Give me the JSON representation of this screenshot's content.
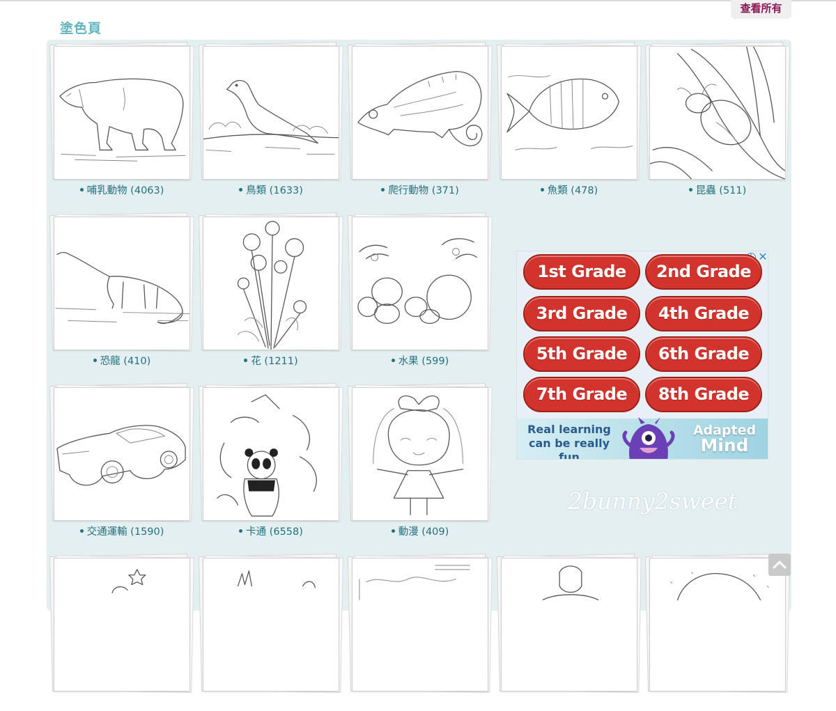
{
  "header": {
    "view_all": "查看所有",
    "section_title": "塗色頁"
  },
  "categories": [
    {
      "label": "哺乳動物 (4063)",
      "icon": "polar-bear"
    },
    {
      "label": "鳥類 (1633)",
      "icon": "bird"
    },
    {
      "label": "爬行動物 (371)",
      "icon": "chameleon"
    },
    {
      "label": "魚類 (478)",
      "icon": "fish"
    },
    {
      "label": "昆蟲 (511)",
      "icon": "ladybug"
    },
    {
      "label": "恐龍 (410)",
      "icon": "dinosaur"
    },
    {
      "label": "花 (1211)",
      "icon": "flowers"
    },
    {
      "label": "水果 (599)",
      "icon": "fruit"
    },
    {
      "label": "交通運輸 (1590)",
      "icon": "car"
    },
    {
      "label": "卡通 (6558)",
      "icon": "cartoon"
    },
    {
      "label": "動漫 (409)",
      "icon": "anime-girl"
    }
  ],
  "ad": {
    "buttons": [
      "1st Grade",
      "2nd Grade",
      "3rd Grade",
      "4th Grade",
      "5th Grade",
      "6th Grade",
      "7th Grade",
      "8th Grade"
    ],
    "tagline": "Real learning can be really fun",
    "brand_line1": "Adapted",
    "brand_line2": "Mind",
    "info_glyph": "i",
    "close_glyph": "✕"
  },
  "watermark": "2bunny2sweet",
  "colors": {
    "accent": "#5fb4bf",
    "link": "#23707e",
    "view_all": "#8b1757",
    "panel": "#e4eff1",
    "ad_button": "#d2332c"
  }
}
